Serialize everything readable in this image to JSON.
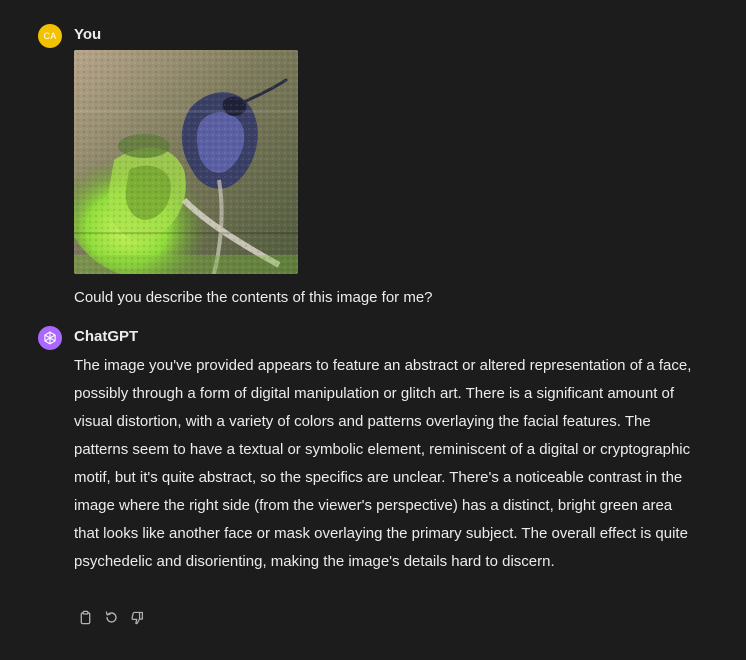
{
  "user_message": {
    "avatar_initials": "CA",
    "author": "You",
    "prompt": "Could you describe the contents of this image for me?",
    "avatar_color": "#f2c200"
  },
  "assistant_message": {
    "author": "ChatGPT",
    "avatar_color": "#ab68ff",
    "avatar_icon": "openai-logo-icon",
    "response": "The image you've provided appears to feature an abstract or altered representation of a face, possibly through a form of digital manipulation or glitch art. There is a significant amount of visual distortion, with a variety of colors and patterns overlaying the facial features. The patterns seem to have a textual or symbolic element, reminiscent of a digital or cryptographic motif, but it's quite abstract, so the specifics are unclear. There's a noticeable contrast in the image where the right side (from the viewer's perspective) has a distinct, bright green area that looks like another face or mask overlaying the primary subject. The overall effect is quite psychedelic and disorienting, making the image's details hard to discern.",
    "actions": [
      "copy-icon",
      "regenerate-icon",
      "thumbs-down-icon"
    ]
  },
  "colors": {
    "background": "#1c1c1c",
    "text": "#ececec",
    "action_icon": "#b4b4b4",
    "image_green": "#8fdc3a"
  }
}
